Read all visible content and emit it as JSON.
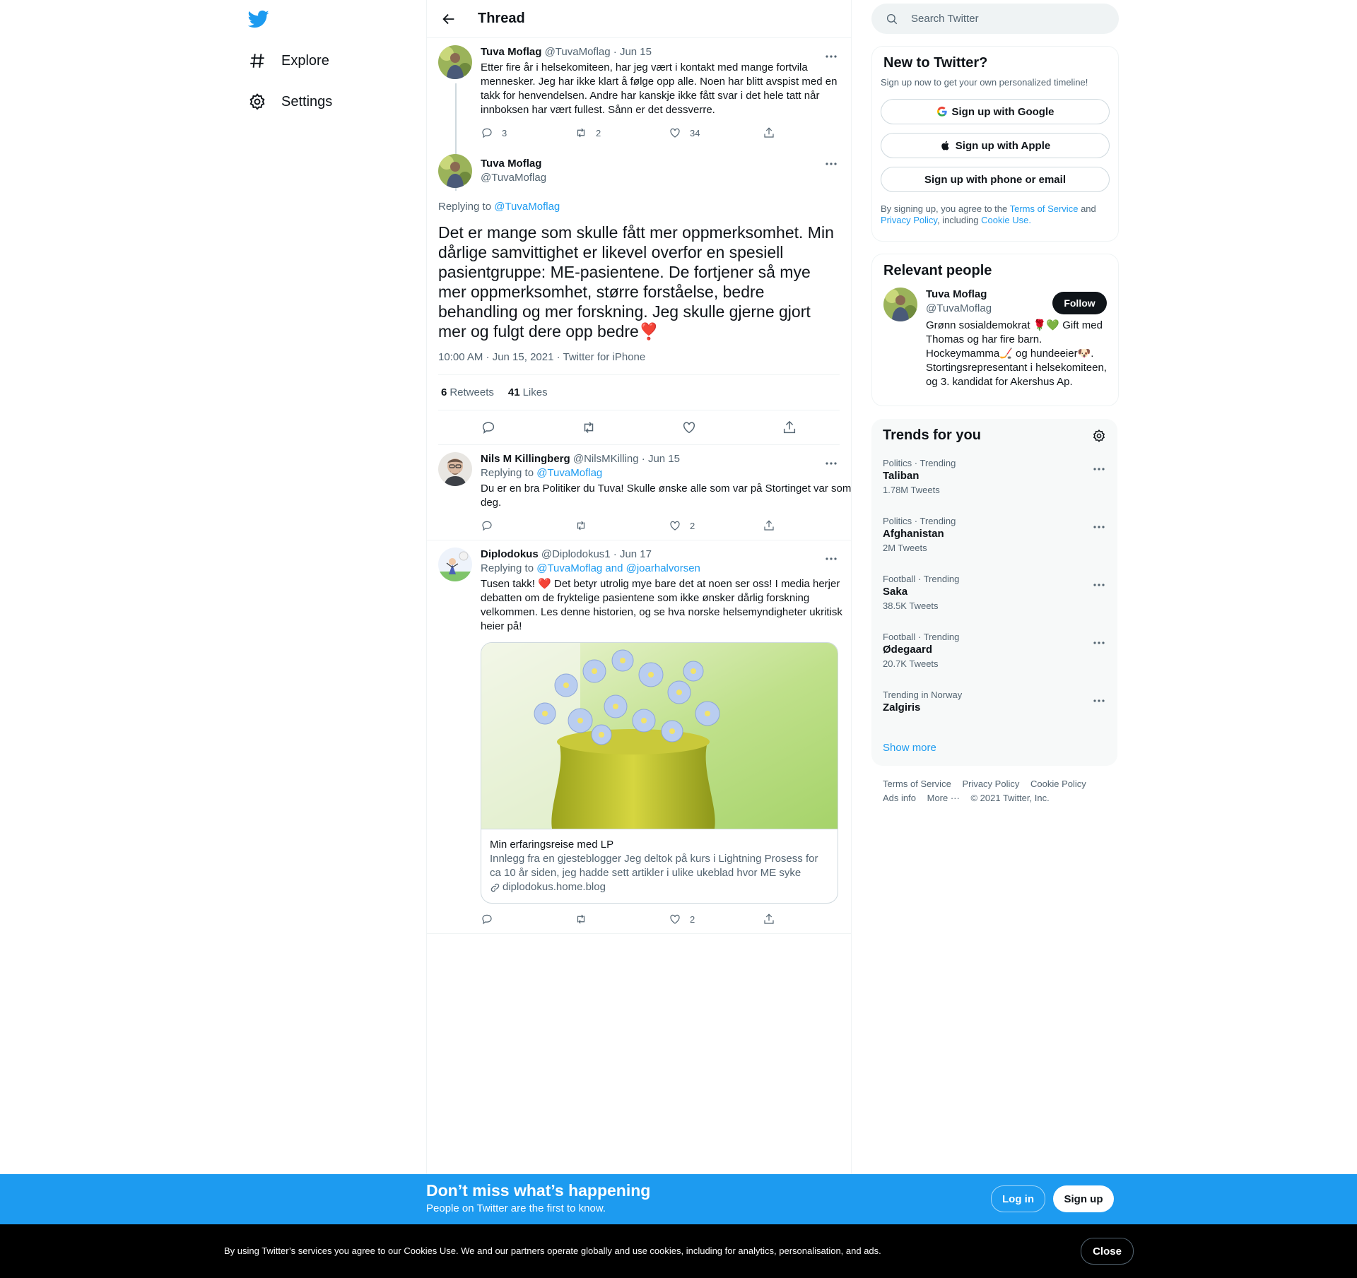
{
  "nav": {
    "explore": "Explore",
    "settings": "Settings"
  },
  "header": {
    "title": "Thread"
  },
  "tweets": {
    "first": {
      "name": "Tuva Moflag",
      "handle": "@TuvaMoflag",
      "date": "· Jun 15",
      "text": "Etter fire år i helsekomiteen, har jeg vært i kontakt med mange fortvila mennesker. Jeg har ikke klart å følge opp alle. Noen har blitt avspist med en takk for henvendelsen. Andre har kanskje ikke fått svar i det hele tatt når innboksen har vært fullest. Sånn er det dessverre.",
      "replies": "3",
      "retweets": "2",
      "likes": "34"
    },
    "main": {
      "name": "Tuva Moflag",
      "handle": "@TuvaMoflag",
      "replying_prefix": "Replying to",
      "replying_to": "@TuvaMoflag",
      "text": "Det er mange som skulle fått mer oppmerksomhet. Min dårlige samvittighet er likevel overfor en spesiell pasientgruppe: ME-pasientene. De fortjener så mye mer oppmerksomhet, større forståelse, bedre behandling og mer forskning. Jeg skulle gjerne gjort mer og fulgt dere opp bedre❣️",
      "meta": "10:00 AM · Jun 15, 2021 · Twitter for iPhone",
      "retweets_count": "6",
      "retweets_label": "Retweets",
      "likes_count": "41",
      "likes_label": "Likes"
    },
    "reply1": {
      "name": "Nils M Killingberg",
      "handle": "@NilsMKilling",
      "date": "· Jun 15",
      "replying_prefix": "Replying to",
      "replying_to": "@TuvaMoflag",
      "text": "Du er en bra Politiker du Tuva! Skulle ønske alle som var på Stortinget var som deg.",
      "likes": "2"
    },
    "reply2": {
      "name": "Diplodokus",
      "handle": "@Diplodokus1",
      "date": "· Jun 17",
      "replying_prefix": "Replying to",
      "replying_to": "@TuvaMoflag and @joarhalvorsen",
      "text": "Tusen takk! ❤️ Det betyr utrolig mye bare det at noen ser oss! I media herjer debatten om de fryktelige pasientene som ikke ønsker dårlig forskning velkommen. Les denne historien, og se hva norske helsemyndigheter ukritisk heier på!",
      "likes": "2",
      "card": {
        "title": "Min erfaringsreise med LP",
        "description": "Innlegg fra en gjesteblogger Jeg deltok på kurs i Lightning Prosess for ca 10 år siden, jeg hadde sett artikler i ulike ukeblad hvor ME syke hevdet...",
        "domain": "diplodokus.home.blog"
      }
    }
  },
  "search": {
    "placeholder": "Search Twitter"
  },
  "new_to_twitter": {
    "title": "New to Twitter?",
    "subtitle": "Sign up now to get your own personalized timeline!",
    "google": "Sign up with Google",
    "apple": "Sign up with Apple",
    "phone": "Sign up with phone or email",
    "legal_1": "By signing up, you agree to the",
    "terms": "Terms of Service",
    "legal_2": "and",
    "privacy": "Privacy Policy",
    "legal_3": ", including",
    "cookie": "Cookie Use."
  },
  "relevant": {
    "title": "Relevant people",
    "name": "Tuva Moflag",
    "handle": "@TuvaMoflag",
    "follow": "Follow",
    "bio": "Grønn sosialdemokrat 🌹💚 Gift med Thomas og har fire barn. Hockeymamma🏒 og hundeeier🐶. Stortingsrepresentant i helsekomiteen, og 3. kandidat for Akershus Ap."
  },
  "trends": {
    "title": "Trends for you",
    "items": [
      {
        "category": "Politics · Trending",
        "name": "Taliban",
        "count": "1.78M Tweets"
      },
      {
        "category": "Politics · Trending",
        "name": "Afghanistan",
        "count": "2M Tweets"
      },
      {
        "category": "Football · Trending",
        "name": "Saka",
        "count": "38.5K Tweets"
      },
      {
        "category": "Football · Trending",
        "name": "Ødegaard",
        "count": "20.7K Tweets"
      },
      {
        "category": "Trending in Norway",
        "name": "Zalgiris",
        "count": ""
      }
    ],
    "show_more": "Show more"
  },
  "footer": {
    "terms": "Terms of Service",
    "privacy": "Privacy Policy",
    "cookie": "Cookie Policy",
    "ads": "Ads info",
    "more": "More ···",
    "copyright": "© 2021 Twitter, Inc."
  },
  "signup_bar": {
    "title": "Don’t miss what’s happening",
    "subtitle": "People on Twitter are the first to know.",
    "login": "Log in",
    "signup": "Sign up"
  },
  "cookie_bar": {
    "text": "By using Twitter’s services you agree to our Cookies Use. We and our partners operate globally and use cookies, including for analytics, personalisation, and ads.",
    "close": "Close"
  },
  "colors": {
    "accent": "#1d9bf0",
    "text": "#0f1419",
    "muted": "#536471"
  }
}
